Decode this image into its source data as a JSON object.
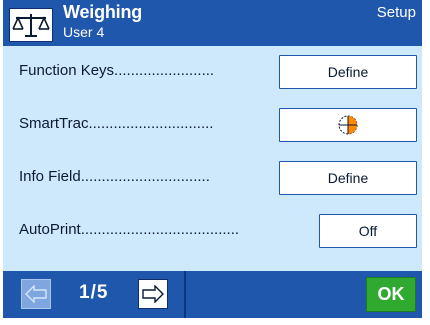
{
  "header": {
    "title": "Weighing",
    "subtitle": "User 4",
    "mode": "Setup"
  },
  "rows": [
    {
      "label": "Function Keys........................",
      "button": "Define"
    },
    {
      "label": "SmartTrac..............................",
      "button": ""
    },
    {
      "label": "Info Field...............................",
      "button": "Define"
    },
    {
      "label": "AutoPrint......................................",
      "button": "Off"
    }
  ],
  "footer": {
    "page": "1/5",
    "ok_label": "OK"
  },
  "colors": {
    "screen_bg": "#cfe9fc",
    "bar_blue": "#1f57ad",
    "ok_green": "#2fa92f",
    "smarttrac_orange": "#ff8a00"
  },
  "icons": [
    "scale-icon",
    "smarttrac-icon",
    "arrow-left-icon",
    "arrow-right-icon"
  ]
}
